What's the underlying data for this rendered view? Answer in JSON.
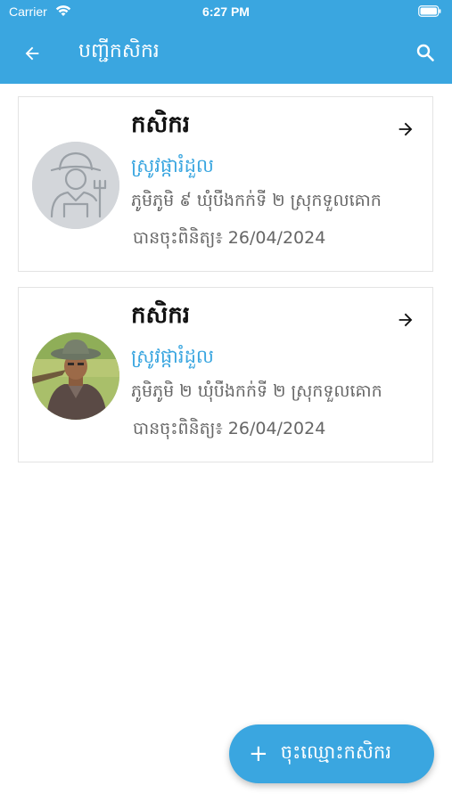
{
  "status_bar": {
    "carrier": "Carrier",
    "time": "6:27 PM"
  },
  "header": {
    "title": "បញ្ជីកសិករ",
    "background_color": "#3aa6e0",
    "back_icon": "arrow-left-icon",
    "search_icon": "search-icon"
  },
  "farmers": [
    {
      "name": "កសិករ",
      "crop": "ស្រូវផ្ការំដួល",
      "address": "ភូមិភូមិ ៩ ឃុំបឹងកក់ទី ២ ស្រុកទួលគោក",
      "registered": "បានចុះពិនិត្យ៖ 26/04/2024",
      "avatar": "farmer-placeholder-icon"
    },
    {
      "name": "កសិករ",
      "crop": "ស្រូវផ្ការំដួល",
      "address": "ភូមិភូមិ ២ ឃុំបឹងកក់ទី ២ ស្រុកទួលគោក",
      "registered": "បានចុះពិនិត្យ៖ 26/04/2024",
      "avatar": "farmer-photo"
    }
  ],
  "fab": {
    "label": "ចុះឈ្មោះកសិករ",
    "icon": "plus-icon"
  }
}
